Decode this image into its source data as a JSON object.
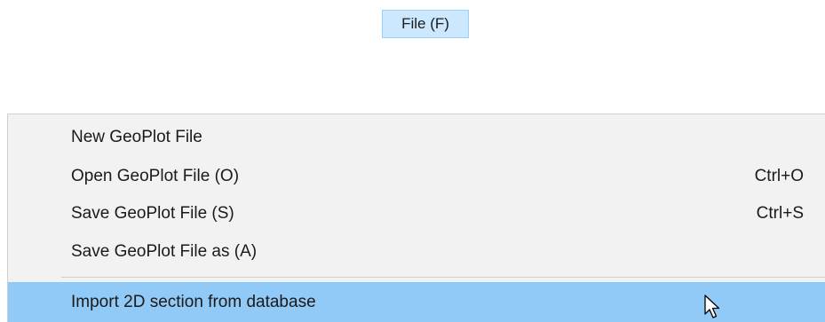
{
  "menubar": {
    "file_label": "File (F)"
  },
  "file_menu": {
    "items": [
      {
        "label": "New GeoPlot File",
        "shortcut": ""
      },
      {
        "label": "Open GeoPlot File (O)",
        "shortcut": "Ctrl+O"
      },
      {
        "label": "Save GeoPlot File (S)",
        "shortcut": "Ctrl+S"
      },
      {
        "label": "Save GeoPlot File as (A)",
        "shortcut": ""
      },
      {
        "label": "Import 2D section from database",
        "shortcut": "",
        "highlighted": true
      }
    ]
  },
  "colors": {
    "menubar_active_bg": "#cce8ff",
    "menu_bg": "#f2f2f2",
    "highlight_bg": "#91c9f7"
  },
  "cursor": {
    "icon": "mouse-pointer-icon"
  }
}
